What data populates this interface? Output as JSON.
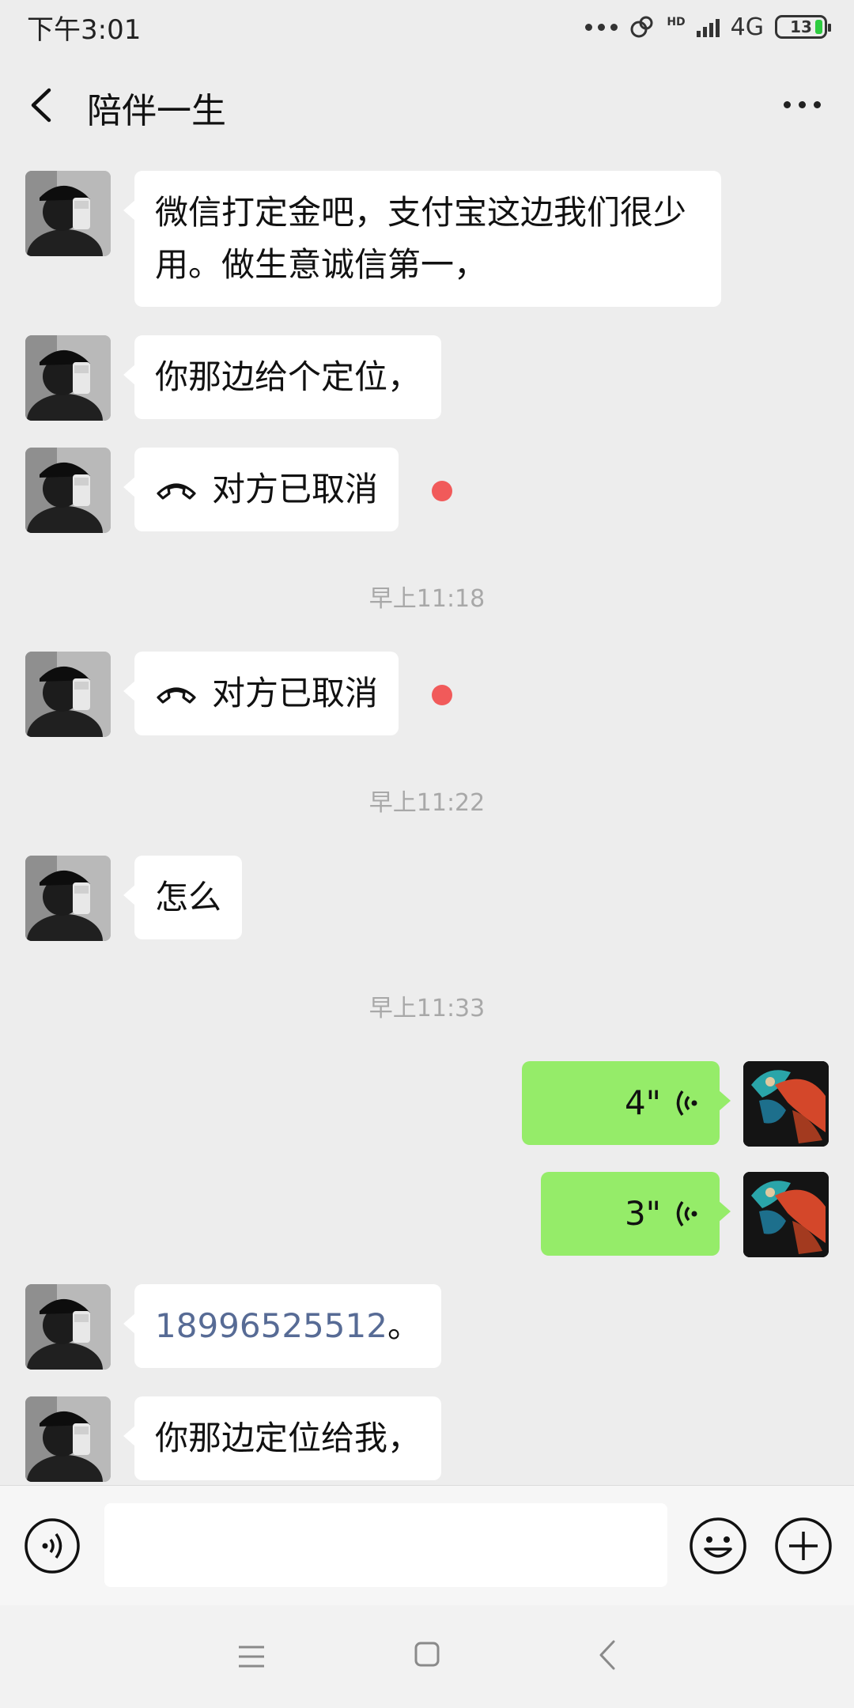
{
  "status_bar": {
    "time": "下午3:01",
    "hd": "HD",
    "network": "4G",
    "battery": "13"
  },
  "header": {
    "title": "陪伴一生"
  },
  "messages": {
    "m1": "微信打定金吧，支付宝这边我们很少用。做生意诚信第一，",
    "m2": "你那边给个定位，",
    "m3": "对方已取消",
    "t1": "早上11:18",
    "m4": "对方已取消",
    "t2": "早上11:22",
    "m5": "怎么",
    "t3": "早上11:33",
    "v1": "4\"",
    "v2": "3\"",
    "m6_number": "18996525512",
    "m6_suffix": "。",
    "m7": "你那边定位给我，"
  },
  "input": {
    "placeholder": ""
  },
  "colors": {
    "background": "#ededed",
    "sent_bubble": "#95ec69",
    "received_bubble": "#ffffff",
    "unread_dot": "#f15a5a",
    "link": "#576b95"
  },
  "icons": [
    "back-icon",
    "more-icon",
    "phone-hangup-icon",
    "voice-wave-icon",
    "voice-input-icon",
    "emoji-icon",
    "plus-icon"
  ]
}
